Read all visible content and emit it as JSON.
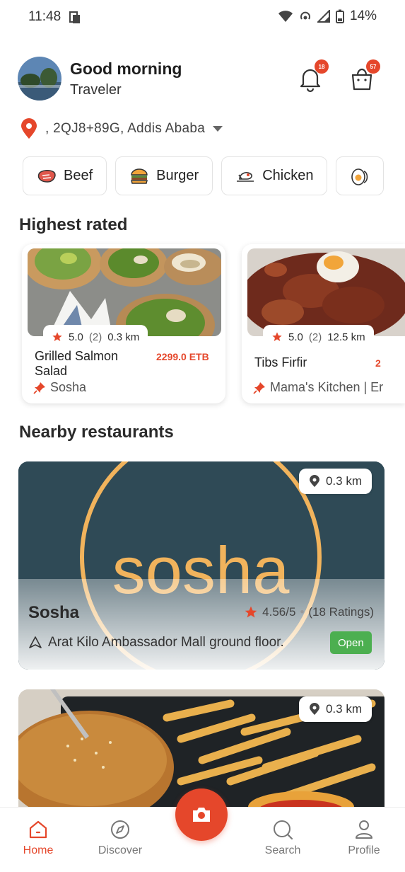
{
  "status_bar": {
    "time": "11:48",
    "battery": "14%"
  },
  "header": {
    "greeting": "Good morning",
    "username": "Traveler",
    "notification_count": "18",
    "cart_count": "57"
  },
  "location": {
    "address": ", 2QJ8+89G,  Addis Ababa"
  },
  "categories": [
    {
      "label": "Beef",
      "icon": "beef-icon"
    },
    {
      "label": "Burger",
      "icon": "burger-icon"
    },
    {
      "label": "Chicken",
      "icon": "chicken-icon"
    },
    {
      "label": "",
      "icon": "egg-icon"
    }
  ],
  "highest_rated": {
    "title": "Highest rated",
    "items": [
      {
        "rating": "5.0",
        "count": "(2)",
        "distance": "0.3 km",
        "name": "Grilled Salmon Salad",
        "price": "2299.0 ETB",
        "restaurant": "Sosha"
      },
      {
        "rating": "5.0",
        "count": "(2)",
        "distance": "12.5 km",
        "name": "Tibs Firfir",
        "price": "2",
        "restaurant": "Mama's Kitchen | Er"
      }
    ]
  },
  "nearby": {
    "title": "Nearby restaurants",
    "restaurants": [
      {
        "logo_text": "sosha",
        "distance": "0.3 km",
        "name": "Sosha",
        "rating": "4.56/5",
        "separator": "•",
        "ratings_count": "(18 Ratings)",
        "address": "Arat Kilo Ambassador Mall ground floor.",
        "status": "Open"
      },
      {
        "distance": "0.3 km"
      }
    ]
  },
  "nav": {
    "items": [
      {
        "label": "Home"
      },
      {
        "label": "Discover"
      },
      {
        "label": "Search"
      },
      {
        "label": "Profile"
      }
    ]
  },
  "colors": {
    "accent": "#e5472b",
    "open": "#4caf50",
    "sosha_bg": "#2f4a56",
    "sosha_logo": "#f1b35c"
  }
}
